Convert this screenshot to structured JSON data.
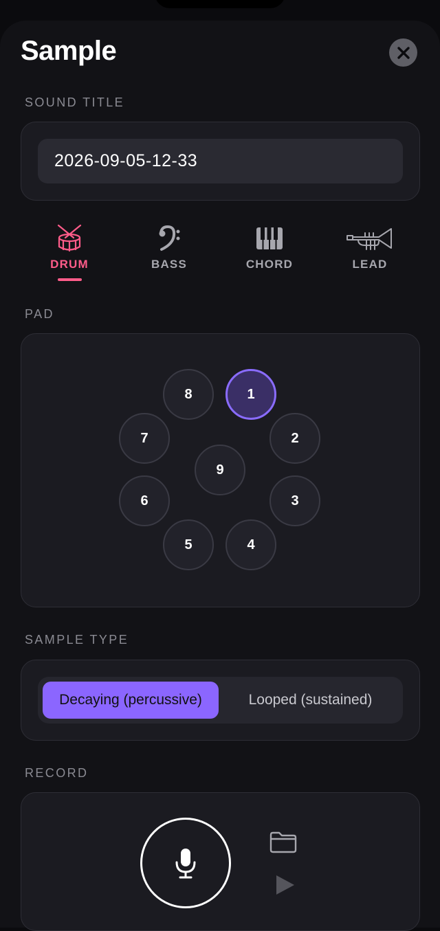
{
  "header": {
    "title": "Sample"
  },
  "sound_title": {
    "label": "SOUND TITLE",
    "value": "2026-09-05-12-33"
  },
  "instrument_tabs": [
    {
      "label": "DRUM",
      "icon": "drum-icon",
      "active": true
    },
    {
      "label": "BASS",
      "icon": "bass-clef-icon",
      "active": false
    },
    {
      "label": "CHORD",
      "icon": "piano-keys-icon",
      "active": false
    },
    {
      "label": "LEAD",
      "icon": "trumpet-icon",
      "active": false
    }
  ],
  "pad_section": {
    "label": "PAD",
    "selected": "1",
    "pads": [
      "1",
      "2",
      "3",
      "4",
      "5",
      "6",
      "7",
      "8",
      "9"
    ]
  },
  "sample_type": {
    "label": "SAMPLE TYPE",
    "options": [
      "Decaying (percussive)",
      "Looped (sustained)"
    ],
    "selected": "Decaying (percussive)"
  },
  "record": {
    "label": "RECORD",
    "icons": [
      "microphone-icon",
      "folder-icon",
      "play-icon"
    ]
  },
  "colors": {
    "accent_pink": "#ff5c8a",
    "accent_purple": "#8b66ff",
    "background": "#0b0b0e",
    "card": "#1b1b21"
  }
}
